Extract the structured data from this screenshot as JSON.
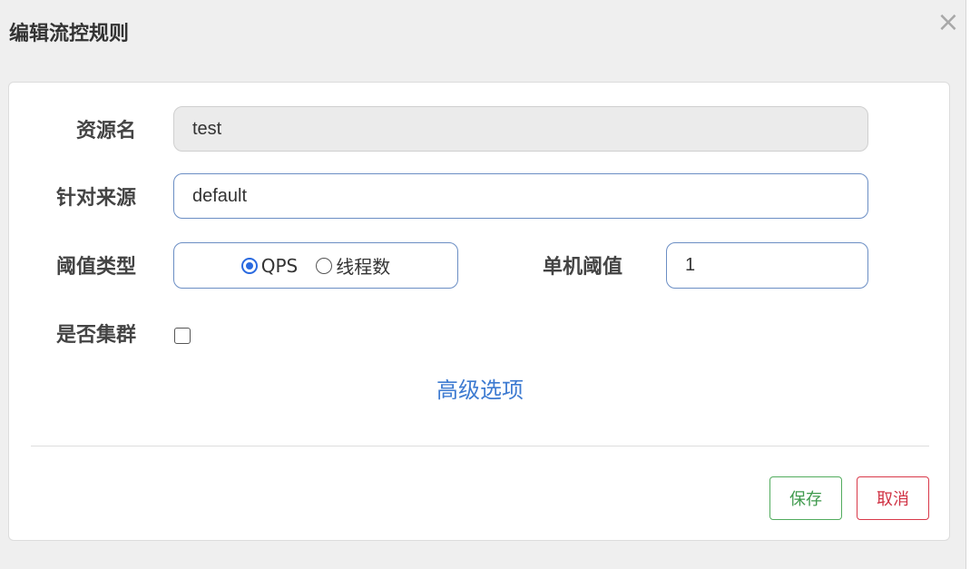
{
  "dialog": {
    "title": "编辑流控规则",
    "close_symbol": "×"
  },
  "form": {
    "resource_label": "资源名",
    "resource_value": "test",
    "origin_label": "针对来源",
    "origin_value": "default",
    "threshold_type_label": "阈值类型",
    "threshold_type_options": [
      {
        "label": "QPS",
        "checked": true
      },
      {
        "label": "线程数",
        "checked": false
      }
    ],
    "single_threshold_label": "单机阈值",
    "single_threshold_value": "1",
    "cluster_label": "是否集群",
    "cluster_checked": false,
    "advanced_link": "高级选项"
  },
  "actions": {
    "save_label": "保存",
    "cancel_label": "取消"
  },
  "colors": {
    "accent_blue": "#2a6ae0",
    "link_blue": "#3e7bd1",
    "save_green": "#3f9a4d",
    "cancel_red": "#d03143"
  }
}
